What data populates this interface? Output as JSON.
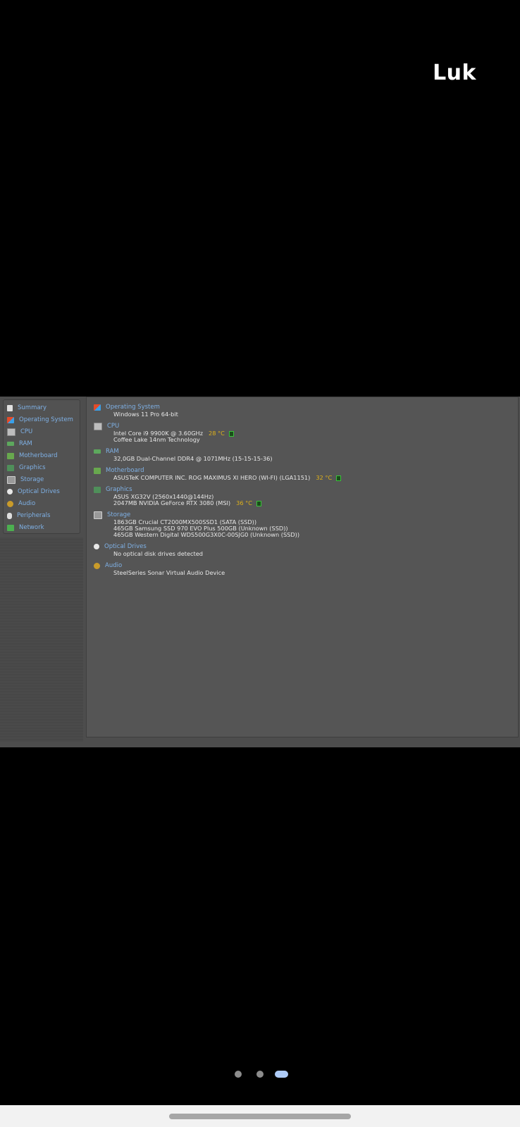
{
  "chat": {
    "sender_name": "Luk"
  },
  "sidebar": {
    "items": [
      {
        "label": "Summary",
        "icon": "summary-icon"
      },
      {
        "label": "Operating System",
        "icon": "windows-icon"
      },
      {
        "label": "CPU",
        "icon": "cpu-icon"
      },
      {
        "label": "RAM",
        "icon": "ram-icon"
      },
      {
        "label": "Motherboard",
        "icon": "motherboard-icon"
      },
      {
        "label": "Graphics",
        "icon": "graphics-icon"
      },
      {
        "label": "Storage",
        "icon": "storage-icon"
      },
      {
        "label": "Optical Drives",
        "icon": "optical-drive-icon"
      },
      {
        "label": "Audio",
        "icon": "audio-icon"
      },
      {
        "label": "Peripherals",
        "icon": "peripherals-icon"
      },
      {
        "label": "Network",
        "icon": "network-icon"
      }
    ]
  },
  "summary": {
    "os": {
      "title": "Operating System",
      "lines": [
        "Windows 11 Pro 64-bit"
      ]
    },
    "cpu": {
      "title": "CPU",
      "lines": [
        "Intel Core i9 9900K @ 3.60GHz",
        "Coffee Lake 14nm Technology"
      ],
      "temp": "28 °C"
    },
    "ram": {
      "title": "RAM",
      "lines": [
        "32,0GB Dual-Channel DDR4 @ 1071MHz (15-15-15-36)"
      ]
    },
    "motherboard": {
      "title": "Motherboard",
      "lines": [
        "ASUSTeK COMPUTER INC. ROG MAXIMUS XI HERO (WI-FI) (LGA1151)"
      ],
      "temp": "32 °C"
    },
    "graphics": {
      "title": "Graphics",
      "lines": [
        "ASUS XG32V (2560x1440@144Hz)",
        "2047MB NVIDIA GeForce RTX 3080 (MSI)"
      ],
      "temp": "36 °C"
    },
    "storage": {
      "title": "Storage",
      "lines": [
        "1863GB Crucial CT2000MX500SSD1 (SATA (SSD))",
        "465GB Samsung SSD 970 EVO Plus 500GB (Unknown (SSD))",
        "465GB Western Digital WDS500G3X0C-00SJG0 (Unknown (SSD))"
      ]
    },
    "optical": {
      "title": "Optical Drives",
      "lines": [
        "No optical disk drives detected"
      ]
    },
    "audio": {
      "title": "Audio",
      "lines": [
        "SteelSeries Sonar Virtual Audio Device"
      ]
    }
  },
  "pager": {
    "page_count": 3,
    "active_page": 3
  },
  "colors": {
    "link_blue": "#7fb1e6",
    "temp_yellow": "#e0b21a",
    "panel_gray": "#555555"
  }
}
